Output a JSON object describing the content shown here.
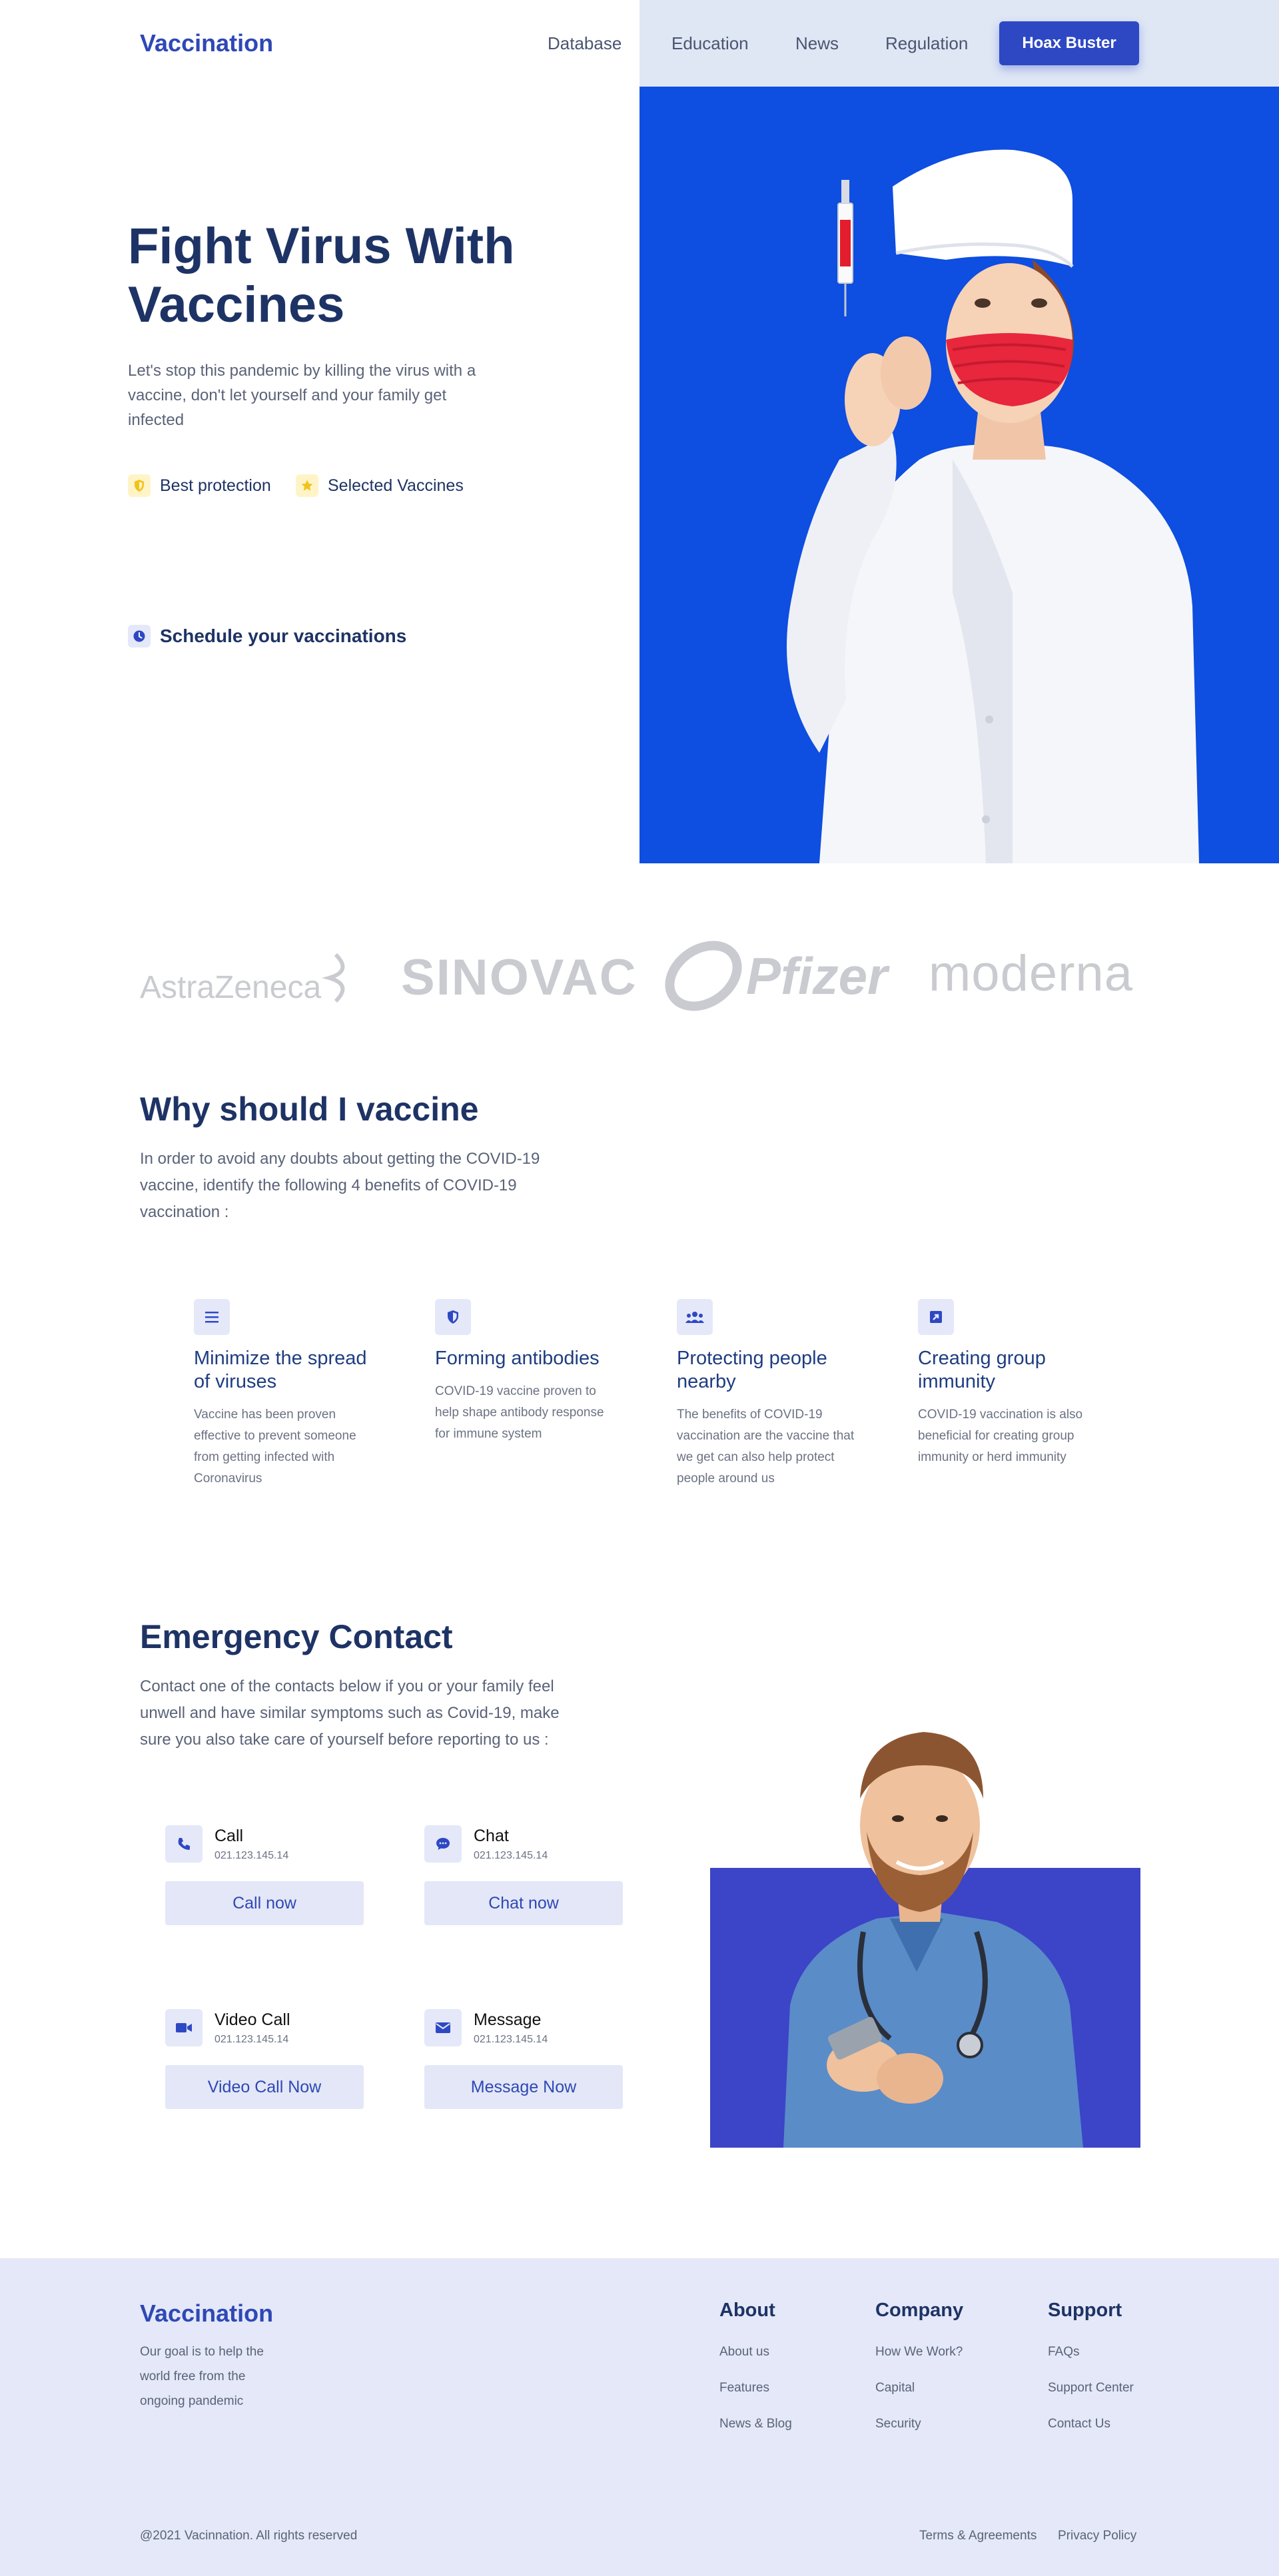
{
  "header": {
    "logo": "Vaccination",
    "nav": [
      "Database",
      "Education",
      "News",
      "Regulation"
    ],
    "cta": "Hoax Buster"
  },
  "hero": {
    "title": "Fight Virus With Vaccines",
    "description": "Let's stop this pandemic by killing the virus with a vaccine, don't let yourself and your family get infected",
    "features": [
      "Best protection",
      "Selected Vaccines"
    ],
    "schedule": "Schedule your vaccinations"
  },
  "brands": [
    "AstraZeneca",
    "SINOVAC",
    "Pfizer",
    "moderna"
  ],
  "why": {
    "title": "Why should I vaccine",
    "description": "In order to avoid any doubts about getting the COVID-19 vaccine, identify the following 4 benefits of COVID-19 vaccination :",
    "benefits": [
      {
        "title": "Minimize the spread of viruses",
        "desc": "Vaccine has been proven effective to prevent someone from getting infected with Coronavirus",
        "icon": "list-icon"
      },
      {
        "title": "Forming antibodies",
        "desc": "COVID-19 vaccine proven to help shape antibody response for immune system",
        "icon": "shield-icon"
      },
      {
        "title": "Protecting people nearby",
        "desc": "The benefits of COVID-19 vaccination are the vaccine that we get can also help protect people around us",
        "icon": "people-icon"
      },
      {
        "title": "Creating group immunity",
        "desc": "COVID-19 vaccination is also beneficial for creating group immunity or herd immunity",
        "icon": "share-icon"
      }
    ]
  },
  "emergency": {
    "title": "Emergency Contact",
    "description": "Contact one of the contacts below if you or your family feel unwell and have similar symptoms such as Covid-19, make sure you also take care of yourself before reporting to us :",
    "contacts": [
      {
        "name": "Call",
        "number": "021.123.145.14",
        "button": "Call now",
        "icon": "phone-icon"
      },
      {
        "name": "Chat",
        "number": "021.123.145.14",
        "button": "Chat now",
        "icon": "chat-icon"
      },
      {
        "name": "Video Call",
        "number": "021.123.145.14",
        "button": "Video Call Now",
        "icon": "video-icon"
      },
      {
        "name": "Message",
        "number": "021.123.145.14",
        "button": "Message Now",
        "icon": "mail-icon"
      }
    ]
  },
  "footer": {
    "logo": "Vaccination",
    "description": "Our goal is to help the world free from the ongoing pandemic",
    "columns": [
      {
        "title": "About",
        "links": [
          "About us",
          "Features",
          "News & Blog"
        ]
      },
      {
        "title": "Company",
        "links": [
          "How We Work?",
          "Capital",
          "Security"
        ]
      },
      {
        "title": "Support",
        "links": [
          "FAQs",
          "Support Center",
          "Contact Us"
        ]
      }
    ],
    "copyright": "@2021 Vacinnation. All rights reserved",
    "legal": [
      "Terms & Agreements",
      "Privacy Policy"
    ]
  },
  "colors": {
    "primary": "#2e48c4",
    "navy": "#1e3365",
    "hero_bg": "#0e4ee0",
    "tint": "#e4e8f8",
    "doctor_bg": "#3c44c8"
  }
}
